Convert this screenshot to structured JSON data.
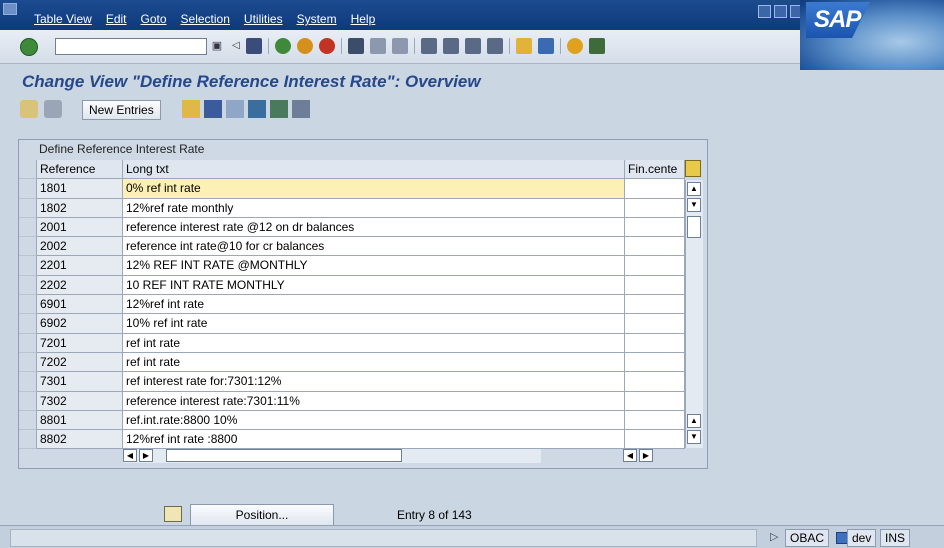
{
  "menu": [
    "Table View",
    "Edit",
    "Goto",
    "Selection",
    "Utilities",
    "System",
    "Help"
  ],
  "logo": "SAP",
  "title": "Change View \"Define Reference Interest Rate\": Overview",
  "toolbar": {
    "new_entries": "New Entries"
  },
  "table": {
    "caption": "Define Reference Interest Rate",
    "headers": {
      "ref": "Reference",
      "lt": "Long txt",
      "fin": "Fin.cente"
    },
    "rows": [
      {
        "ref": "1801",
        "lt": "0% ref int rate"
      },
      {
        "ref": "1802",
        "lt": "12%ref rate monthly"
      },
      {
        "ref": "2001",
        "lt": "reference interest rate @12 on dr balances"
      },
      {
        "ref": "2002",
        "lt": "reference int rate@10 for cr balances"
      },
      {
        "ref": "2201",
        "lt": "12% REF INT RATE @MONTHLY"
      },
      {
        "ref": "2202",
        "lt": "10 REF INT RATE MONTHLY"
      },
      {
        "ref": "6901",
        "lt": "12%ref int rate"
      },
      {
        "ref": "6902",
        "lt": "10% ref int rate"
      },
      {
        "ref": "7201",
        "lt": "ref int rate"
      },
      {
        "ref": "7202",
        "lt": "ref int rate"
      },
      {
        "ref": "7301",
        "lt": "ref interest rate for:7301:12%"
      },
      {
        "ref": "7302",
        "lt": "reference interest rate:7301:11%"
      },
      {
        "ref": "8801",
        "lt": "ref.int.rate:8800 10%"
      },
      {
        "ref": "8802",
        "lt": "12%ref int rate :8800"
      }
    ]
  },
  "position_button": "Position...",
  "entry_text": "Entry 8 of 143",
  "status": {
    "system": "OBAC",
    "server": "dev",
    "mode": "INS"
  }
}
